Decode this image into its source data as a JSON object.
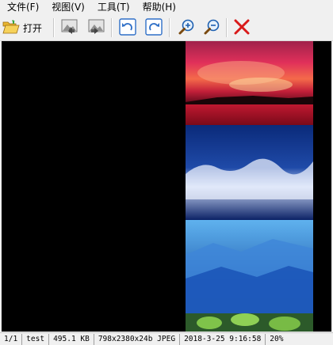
{
  "menu": {
    "file": "文件(F)",
    "view": "视图(V)",
    "tools": "工具(T)",
    "help": "帮助(H)"
  },
  "toolbar": {
    "open_label": "打开",
    "icons": [
      "folder-open-icon",
      "previous-image-icon",
      "next-image-icon",
      "rotate-left-icon",
      "rotate-right-icon",
      "zoom-in-icon",
      "zoom-out-icon",
      "close-icon"
    ]
  },
  "status": {
    "index": "1/1",
    "name": "test",
    "size": "495.1 KB",
    "dimensions": "798x2380x24b JPEG",
    "datetime": "2018-3-25 9:16:58",
    "zoom": "20%"
  },
  "colors": {
    "delete_red": "#d91a1a",
    "rotate_blue": "#2f6fc7",
    "viewer_bg": "#000000"
  }
}
